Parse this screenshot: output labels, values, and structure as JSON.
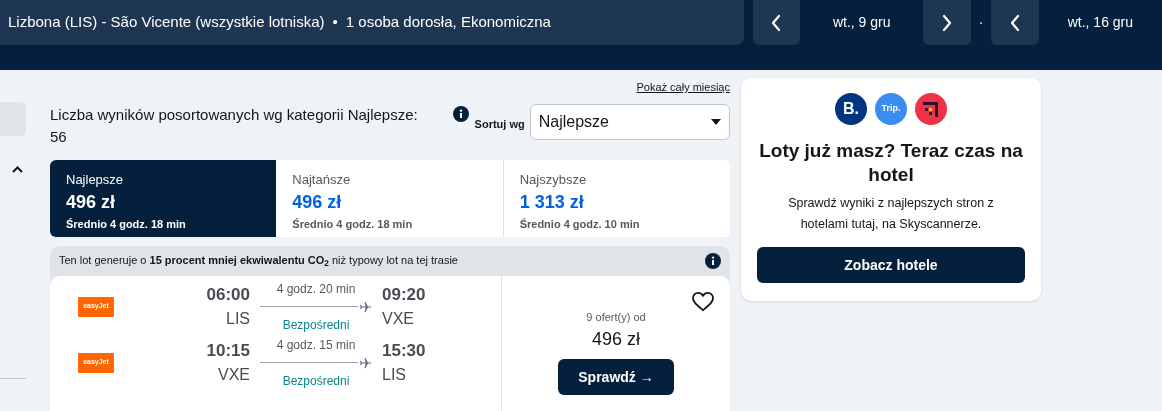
{
  "header": {
    "route": "Lizbona (LIS) - São Vicente (wszystkie lotniska)",
    "passengers": "1 osoba dorosła, Ekonomiczna",
    "separator": "•",
    "nav": [
      {
        "kind": "prev"
      },
      {
        "kind": "date",
        "label": "wt., 9 gru"
      },
      {
        "kind": "next"
      },
      {
        "kind": "dot",
        "label": "·"
      },
      {
        "kind": "prev"
      },
      {
        "kind": "date",
        "label": "wt., 16 gru"
      }
    ]
  },
  "month_link": "Pokaż cały miesiąc",
  "results": {
    "summary": "Liczba wyników posortowanych wg kategorii Najlepsze: 56",
    "sort_label": "Sortuj wg",
    "sort_value": "Najlepsze"
  },
  "tabs": [
    {
      "label": "Najlepsze",
      "price": "496 zł",
      "duration": "Średnio 4 godz. 18 min",
      "selected": true
    },
    {
      "label": "Najtańsze",
      "price": "496 zł",
      "duration": "Średnio 4 godz. 18 min",
      "selected": false
    },
    {
      "label": "Najszybsze",
      "price": "1 313 zł",
      "duration": "Średnio 4 godz. 10 min",
      "selected": false
    }
  ],
  "eco_note": "Ten lot generuje o **15 procent mniej ekwiwalentu CO$_{2}$** niż typowy lot na tej trasie",
  "flight": {
    "legs": [
      {
        "airline": "easyJet",
        "depart": "06:00",
        "from": "LIS",
        "duration": "4 godz. 20 min",
        "stops": "Bezpośredni",
        "arrive": "09:20",
        "to": "VXE"
      },
      {
        "airline": "easyJet",
        "depart": "10:15",
        "from": "VXE",
        "duration": "4 godz. 15 min",
        "stops": "Bezpośredni",
        "arrive": "15:30",
        "to": "LIS"
      }
    ],
    "offers": "9 ofert(y) od",
    "price": "496 zł",
    "button": "Sprawdź →",
    "favorite": false
  },
  "hotel_card": {
    "logos": [
      {
        "kind": "booking",
        "text": "B."
      },
      {
        "kind": "trip",
        "text": "Trip."
      },
      {
        "kind": "hotels"
      }
    ],
    "title": "Loty już masz? Teraz czas na hotel",
    "text": "Sprawdź wyniki z najlepszych stron z hotelami tutaj, na Skyscannerze.",
    "button": "Zobacz hotele"
  }
}
